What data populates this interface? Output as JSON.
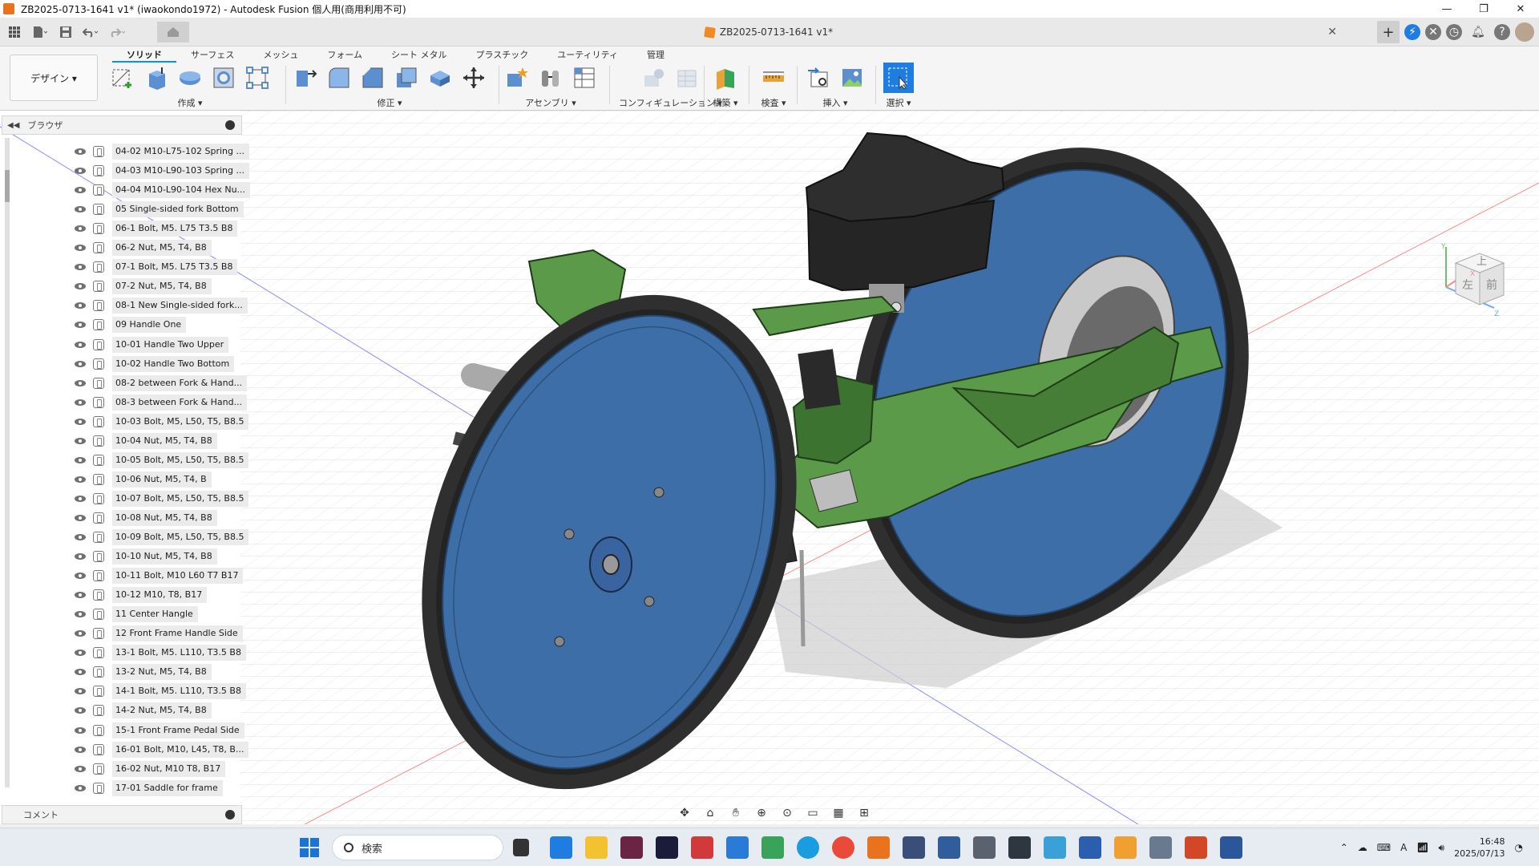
{
  "window": {
    "title": "ZB2025-0713-1641 v1* (iwaokondo1972) - Autodesk Fusion 個人用(商用利用不可)",
    "controls": [
      "—",
      "❐",
      "✕"
    ]
  },
  "document": {
    "tab_title": "ZB2025-0713-1641 v1*",
    "close": "✕"
  },
  "ribbon": {
    "workspace_button": "デザイン ▾",
    "tabs": [
      "ソリッド",
      "サーフェス",
      "メッシュ",
      "フォーム",
      "シート メタル",
      "プラスチック",
      "ユーティリティ",
      "管理"
    ],
    "active_tab": "ソリッド",
    "groups": {
      "create": "作成 ▾",
      "modify": "修正 ▾",
      "assemble": "アセンブリ ▾",
      "configure": "コンフィギュレーション ▾",
      "construct": "構築 ▾",
      "inspect": "検査 ▾",
      "insert": "挿入 ▾",
      "select": "選択 ▾"
    }
  },
  "browser": {
    "title": "ブラウザ",
    "items": [
      "04-02 M10-L75-102 Spring ...",
      "04-03 M10-L90-103 Spring ...",
      "04-04 M10-L90-104 Hex Nu...",
      "05 Single-sided fork Bottom",
      "06-1 Bolt, M5. L75 T3.5 B8",
      "06-2 Nut, M5, T4, B8",
      "07-1 Bolt, M5. L75 T3.5 B8",
      "07-2 Nut, M5, T4, B8",
      "08-1 New Single-sided fork...",
      "09 Handle One",
      "10-01 Handle Two Upper",
      "10-02 Handle Two Bottom",
      "08-2 between Fork & Hand...",
      "08-3 between Fork & Hand...",
      "10-03 Bolt, M5, L50, T5, B8.5",
      "10-04 Nut, M5, T4, B8",
      "10-05 Bolt, M5, L50, T5, B8.5",
      "10-06 Nut, M5, T4, B",
      "10-07 Bolt, M5, L50, T5, B8.5",
      "10-08 Nut, M5, T4, B8",
      "10-09 Bolt, M5, L50, T5, B8.5",
      "10-10 Nut, M5, T4, B8",
      "10-11 Bolt, M10 L60 T7 B17",
      "10-12 M10, T8, B17",
      "11 Center Hangle",
      "12 Front Frame Handle Side",
      "13-1 Bolt, M5. L110, T3.5 B8",
      "13-2 Nut, M5, T4, B8",
      "14-1 Bolt, M5. L110, T3.5 B8",
      "14-2 Nut, M5, T4, B8",
      "15-1 Front Frame Pedal Side",
      "16-01 Bolt, M10, L45, T8, B...",
      "16-02 Nut, M10 T8, B17",
      "17-01 Saddle for frame"
    ]
  },
  "comments": {
    "title": "コメント"
  },
  "viewcube": {
    "top_face": "上",
    "left_face": "左",
    "front_face": "前",
    "axis_x": "X",
    "axis_y": "Y",
    "axis_z": "Z"
  },
  "taskbar": {
    "search_placeholder": "検索",
    "time": "16:48",
    "date": "2025/07/13",
    "ime": "A"
  },
  "colors": {
    "accent": "#0696d7",
    "wheel_blue": "#3e6ea8",
    "frame_green": "#5a9a48",
    "tire": "#2f2f2f"
  }
}
